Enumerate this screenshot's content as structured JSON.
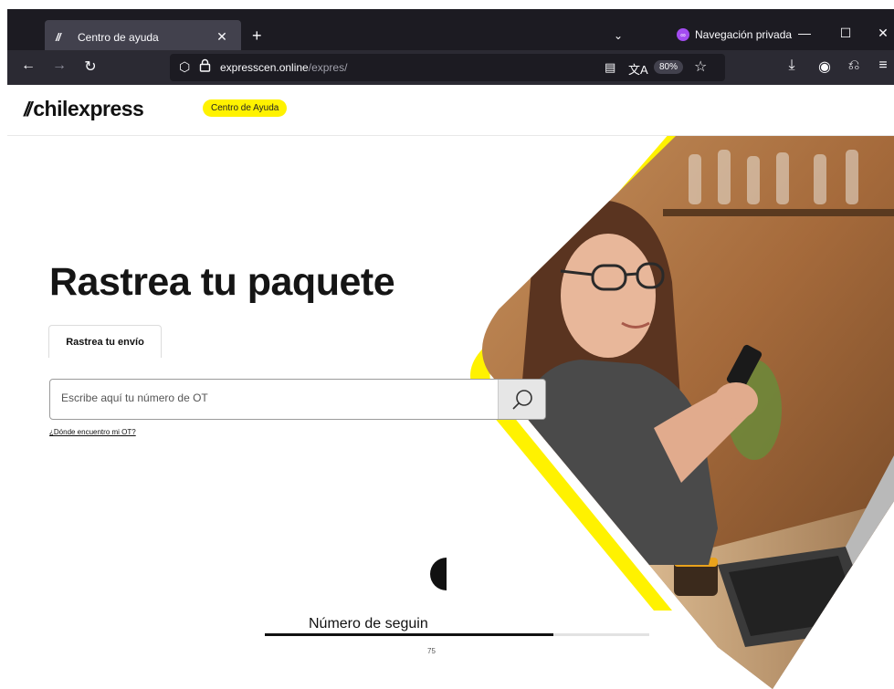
{
  "browser": {
    "tab": {
      "title": "Centro de ayuda",
      "icon": "chilexpress-favicon",
      "close_icon": "close-icon"
    },
    "new_tab_icon": "plus-icon",
    "tab_list_icon": "chevron-down-icon",
    "private_mode_label": "Navegación privada",
    "window_controls": [
      "minimize-icon",
      "maximize-icon",
      "close-icon"
    ],
    "url": {
      "domain": "expresscen.online",
      "path": "/expres/"
    },
    "zoom_level": "80%",
    "nav_icons": [
      "back-icon",
      "forward-icon",
      "reload-icon",
      "shield-icon",
      "lock-icon",
      "reader-view-icon",
      "translate-icon",
      "bookmark-star-icon",
      "download-icon",
      "account-icon",
      "extensions-icon",
      "menu-icon"
    ]
  },
  "site": {
    "logo_text": "chilexpress",
    "help_badge": "Centro de Ayuda",
    "brand_color": "#fff200"
  },
  "hero": {
    "headline": "Rastrea tu paquete",
    "tab_label": "Rastrea tu envío",
    "search_placeholder": "Escribe aquí tu número de OT",
    "search_icon": "search-icon",
    "find_ot_link": "¿Dónde encuentro mi OT?"
  },
  "progress": {
    "label": "Número de seguin",
    "value": "75",
    "fraction": 0.75
  }
}
